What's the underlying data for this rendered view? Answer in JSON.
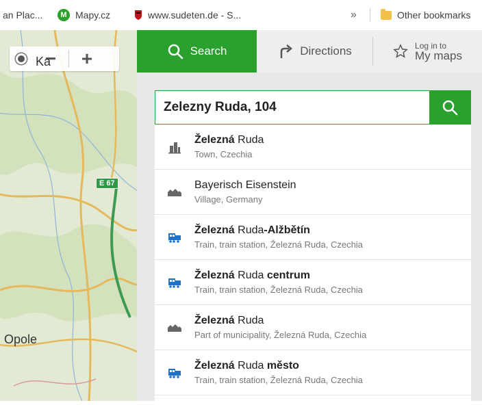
{
  "bookmarks": {
    "items": [
      {
        "label": "an Plac..."
      },
      {
        "label": "Mapy.cz"
      },
      {
        "label": "www.sudeten.de - S..."
      }
    ],
    "overflow": "»",
    "other": "Other bookmarks"
  },
  "map": {
    "labels": {
      "city": "Opole",
      "partial": "Ka"
    },
    "road": "E 67",
    "controls": {
      "zoom_out": "−",
      "zoom_in": "+"
    }
  },
  "tabs": {
    "search": "Search",
    "directions": "Directions",
    "login_line1": "Log in to",
    "login_line2": "My maps"
  },
  "search": {
    "value": "Zelezny Ruda, 104"
  },
  "results": [
    {
      "icon": "town-icon",
      "bold": "Železná",
      "rest": " Ruda",
      "sub": "Town, Czechia"
    },
    {
      "icon": "village-icon",
      "bold": "",
      "rest": "Bayerisch Eisenstein",
      "sub": "Village, Germany"
    },
    {
      "icon": "train-icon",
      "bold": "Železná",
      "rest": " Ruda",
      "bold2": "-Alžbětín",
      "sub": "Train, train station, Železná Ruda, Czechia"
    },
    {
      "icon": "train-icon",
      "bold": "Železná",
      "rest": " Ruda ",
      "bold2": "centrum",
      "sub": "Train, train station, Železná Ruda, Czechia"
    },
    {
      "icon": "village-icon",
      "bold": "Železná",
      "rest": " Ruda",
      "sub": "Part of municipality, Železná Ruda, Czechia"
    },
    {
      "icon": "train-icon",
      "bold": "Železná",
      "rest": " Ruda ",
      "bold2": "město",
      "sub": "Train, train station, Železná Ruda, Czechia"
    }
  ],
  "colors": {
    "brand_green": "#2aa02f",
    "train_blue": "#1e73c9"
  }
}
